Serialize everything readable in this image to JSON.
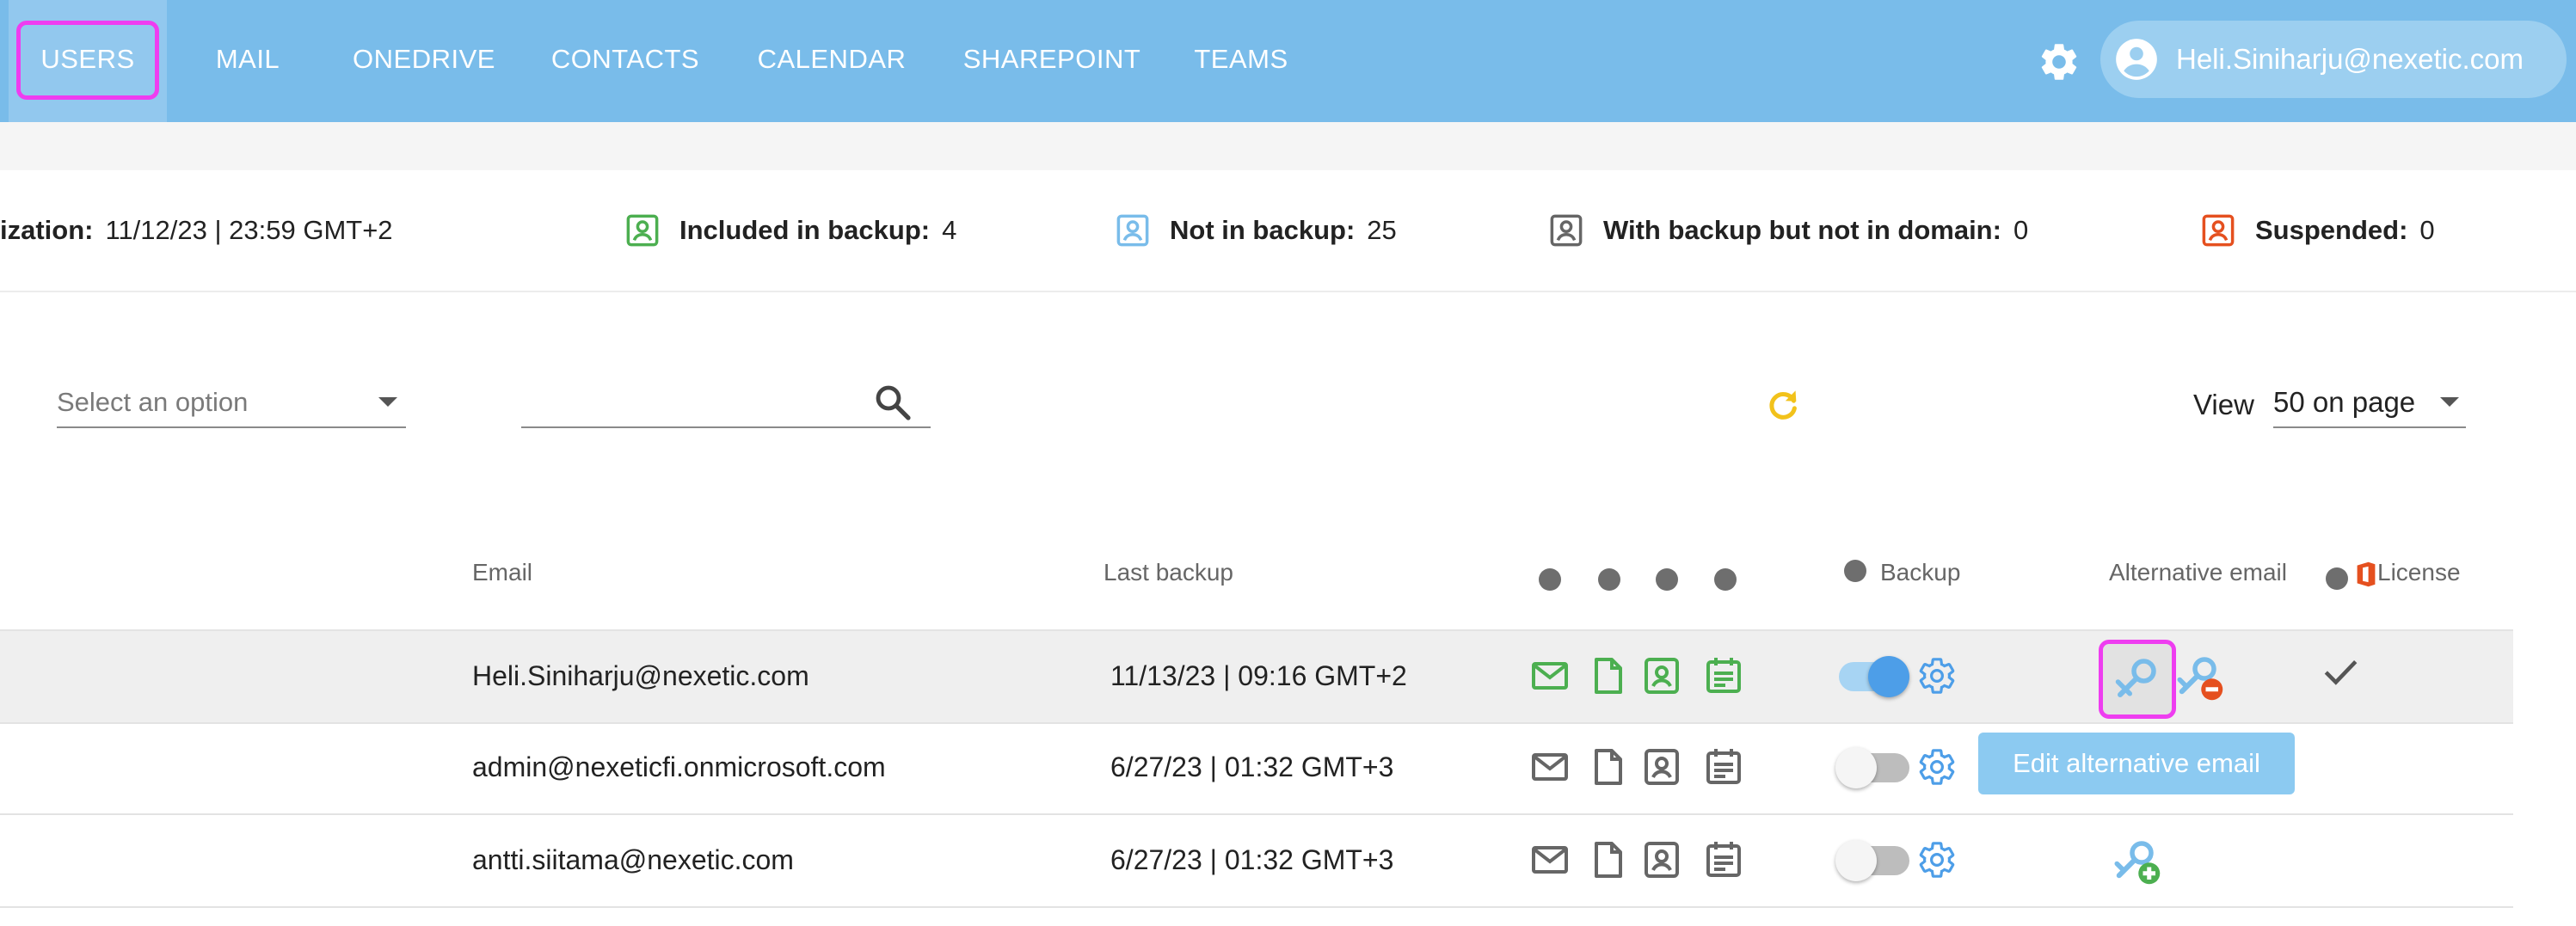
{
  "nav": {
    "tabs": [
      {
        "label": "USERS"
      },
      {
        "label": "MAIL"
      },
      {
        "label": "ONEDRIVE"
      },
      {
        "label": "CONTACTS"
      },
      {
        "label": "CALENDAR"
      },
      {
        "label": "SHAREPOINT"
      },
      {
        "label": "TEAMS"
      }
    ],
    "active_tab": "USERS",
    "user_email": "Heli.Siniharju@nexetic.com",
    "settings_icon": "gear-icon",
    "avatar_icon": "account-circle-icon"
  },
  "stats": {
    "sync_label": "ization:",
    "sync_value": "11/12/23 | 23:59 GMT+2",
    "included_label": "Included in backup:",
    "included_value": "4",
    "not_in_label": "Not in backup:",
    "not_in_value": "25",
    "not_domain_label": "With backup but not in domain:",
    "not_domain_value": "0",
    "suspended_label": "Suspended:",
    "suspended_value": "0"
  },
  "filters": {
    "select_placeholder": "Select an option",
    "search_value": "",
    "view_label": "View",
    "view_value": "50 on page"
  },
  "table": {
    "headers": {
      "email": "Email",
      "last_backup": "Last backup",
      "backup": "Backup",
      "alt_email": "Alternative email",
      "license": "License"
    },
    "rows": [
      {
        "email": "Heli.Siniharju@nexetic.com",
        "last_backup": "11/13/23 | 09:16 GMT+2",
        "backup_on": true,
        "services_active": true,
        "alt_email_state": "edit-remove",
        "license": true
      },
      {
        "email": "admin@nexeticfi.onmicrosoft.com",
        "last_backup": "6/27/23 | 01:32 GMT+3",
        "backup_on": false,
        "services_active": false,
        "alt_email_state": "none",
        "license": false
      },
      {
        "email": "antti.siitama@nexetic.com",
        "last_backup": "6/27/23 | 01:32 GMT+3",
        "backup_on": false,
        "services_active": false,
        "alt_email_state": "add",
        "license": false
      }
    ]
  },
  "tooltip": {
    "text": "Edit alternative email"
  },
  "colors": {
    "nav_bg": "#79bcea",
    "stat_green": "#4caf50",
    "stat_blue": "#79bcea",
    "stat_gray": "#666666",
    "stat_red": "#e5501f",
    "refresh_yellow": "#f2c21b",
    "highlight": "#ee3df0"
  }
}
